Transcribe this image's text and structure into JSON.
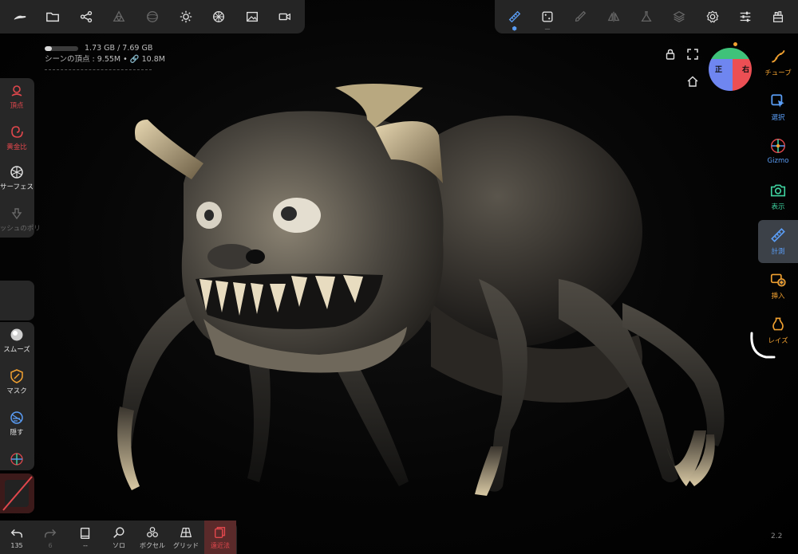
{
  "stats": {
    "memory": "1.73 GB / 7.69 GB",
    "memory_fraction": 0.225,
    "scene": "シーンの頂点 : 9.55M • 🔗 10.8M"
  },
  "top_left_tools": [
    "sculpt-brush-icon",
    "folder-icon",
    "share-icon",
    "mesh-icon",
    "sphere-icon",
    "light-icon",
    "material-icon",
    "image-icon",
    "video-icon"
  ],
  "top_right_tools": [
    "measure-icon",
    "dice-icon",
    "brush-icon",
    "symmetry-icon",
    "flask-icon",
    "layers-icon",
    "gear-icon",
    "sliders-icon",
    "scene-icon"
  ],
  "left_tools": {
    "vertex": "頂点",
    "golden_ratio": "黄金比",
    "surface": "サーフェス",
    "mesh_poly": "メッシュのポリ",
    "smooth": "スムーズ",
    "mask": "マスク",
    "hide": "隠す"
  },
  "right_tools": {
    "tube": "チューブ",
    "select": "選択",
    "gizmo": "Gizmo",
    "view": "表示",
    "measure": "計測",
    "insert": "挿入",
    "lathe": "レイズ"
  },
  "bottom_tools": {
    "undo_count": "135",
    "redo_count": "6",
    "history_label": "--",
    "solo": "ソロ",
    "voxel": "ボクセル",
    "grid": "グリッド",
    "perspective": "遠近法"
  },
  "view_cube": {
    "front": "正",
    "right": "右"
  },
  "version": "2.2",
  "colors": {
    "accent_red": "#e0474c",
    "accent_blue": "#5a9df5",
    "accent_orange": "#f0a030",
    "accent_green": "#3fd3a0"
  }
}
